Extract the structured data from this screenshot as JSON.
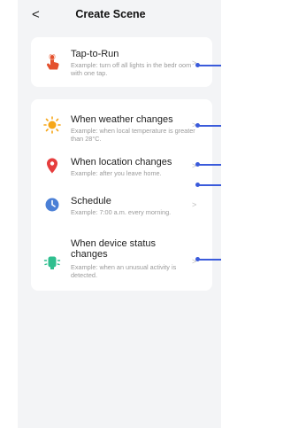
{
  "header": {
    "back": "<",
    "title": "Create Scene"
  },
  "items": [
    {
      "title": "Tap-to-Run",
      "desc": "Example: turn off all lights in the bedr oom with one tap.",
      "icon": "tap-hand-icon",
      "color": "#e4512e"
    },
    {
      "title": "When weather changes",
      "desc": "Example: when local temperature is greater than 28°C.",
      "icon": "sun-icon",
      "color": "#f6a618"
    },
    {
      "title": "When location changes",
      "desc": "Example: after you leave home.",
      "icon": "location-pin-icon",
      "color": "#e63d3d"
    },
    {
      "title": "Schedule",
      "desc": "Example: 7:00 a.m. every morning.",
      "icon": "clock-icon",
      "color": "#4a7fd6"
    },
    {
      "title": "When device status changes",
      "desc": "Example: when an unusual activity is detected.",
      "icon": "device-icon",
      "color": "#2fbf8f"
    }
  ],
  "chevron": ">"
}
